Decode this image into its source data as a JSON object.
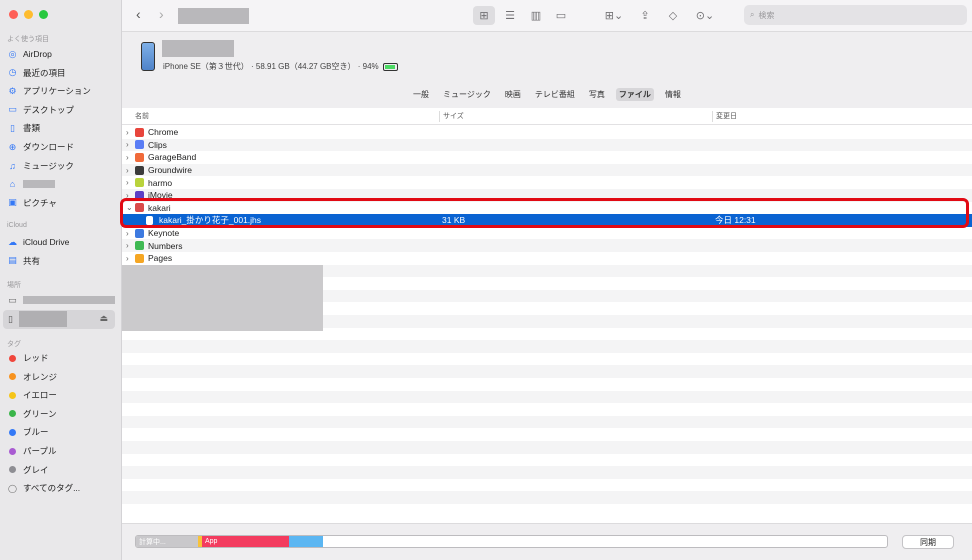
{
  "sidebar": {
    "favorites_header": "よく使う項目",
    "favorites": [
      {
        "label": "AirDrop",
        "icon": "airdrop-icon",
        "glyph": "◎"
      },
      {
        "label": "最近の項目",
        "icon": "clock-icon",
        "glyph": "◷"
      },
      {
        "label": "アプリケーション",
        "icon": "applications-icon",
        "glyph": "⚙"
      },
      {
        "label": "デスクトップ",
        "icon": "desktop-icon",
        "glyph": "▭"
      },
      {
        "label": "書類",
        "icon": "document-icon",
        "glyph": "▯"
      },
      {
        "label": "ダウンロード",
        "icon": "download-icon",
        "glyph": "⊕"
      },
      {
        "label": "ミュージック",
        "icon": "music-icon",
        "glyph": "♫"
      },
      {
        "label": "",
        "icon": "home-icon",
        "glyph": "⌂"
      },
      {
        "label": "ピクチャ",
        "icon": "pictures-icon",
        "glyph": "▣"
      }
    ],
    "icloud_header": "iCloud",
    "icloud": [
      {
        "label": "iCloud Drive",
        "icon": "cloud-icon",
        "glyph": "☁"
      },
      {
        "label": "共有",
        "icon": "shared-folder-icon",
        "glyph": "▤"
      }
    ],
    "locations_header": "場所",
    "tags_header": "タグ",
    "tags": [
      {
        "label": "レッド",
        "color": "#f0463c"
      },
      {
        "label": "オレンジ",
        "color": "#f7921e"
      },
      {
        "label": "イエロー",
        "color": "#f5c518"
      },
      {
        "label": "グリーン",
        "color": "#3ab54a"
      },
      {
        "label": "ブルー",
        "color": "#3479f6"
      },
      {
        "label": "パープル",
        "color": "#a95bd2"
      },
      {
        "label": "グレイ",
        "color": "#8e8e93"
      }
    ],
    "all_tags": "すべてのタグ..."
  },
  "toolbar": {
    "search_placeholder": "検索"
  },
  "device": {
    "info": "iPhone SE（第３世代） · 58.91 GB（44.27 GB空き） · 94%"
  },
  "tabs": [
    "一般",
    "ミュージック",
    "映画",
    "テレビ番組",
    "写真",
    "ファイル",
    "情報"
  ],
  "selected_tab": "ファイル",
  "columns": {
    "name": "名前",
    "size": "サイズ",
    "date": "変更日"
  },
  "rows": [
    {
      "name": "Chrome",
      "size": "",
      "date": "",
      "color": "#e8453c",
      "expanded": false
    },
    {
      "name": "Clips",
      "size": "",
      "date": "",
      "color": "#5a7df5",
      "expanded": false
    },
    {
      "name": "GarageBand",
      "size": "",
      "date": "",
      "color": "#f06a3a",
      "expanded": false
    },
    {
      "name": "Groundwire",
      "size": "",
      "date": "",
      "color": "#3b3b3b",
      "expanded": false
    },
    {
      "name": "harmo",
      "size": "",
      "date": "",
      "color": "#b9d33c",
      "expanded": false
    },
    {
      "name": "iMovie",
      "size": "",
      "date": "",
      "color": "#5b3fc5",
      "expanded": false
    },
    {
      "name": "kakari",
      "size": "",
      "date": "",
      "color": "#d94a4a",
      "expanded": true
    },
    {
      "name": "kakari_掛かり花子_001.jhs",
      "size": "31 KB",
      "date": "今日 12:31",
      "child": true,
      "selected": true
    },
    {
      "name": "Keynote",
      "size": "",
      "date": "",
      "color": "#3d7ae0",
      "expanded": false
    },
    {
      "name": "Numbers",
      "size": "",
      "date": "",
      "color": "#3fb953",
      "expanded": false
    },
    {
      "name": "Pages",
      "size": "",
      "date": "",
      "color": "#f5a623",
      "expanded": false
    }
  ],
  "footer": {
    "calculating": "計算中...",
    "app": "App",
    "sync": "同期"
  }
}
